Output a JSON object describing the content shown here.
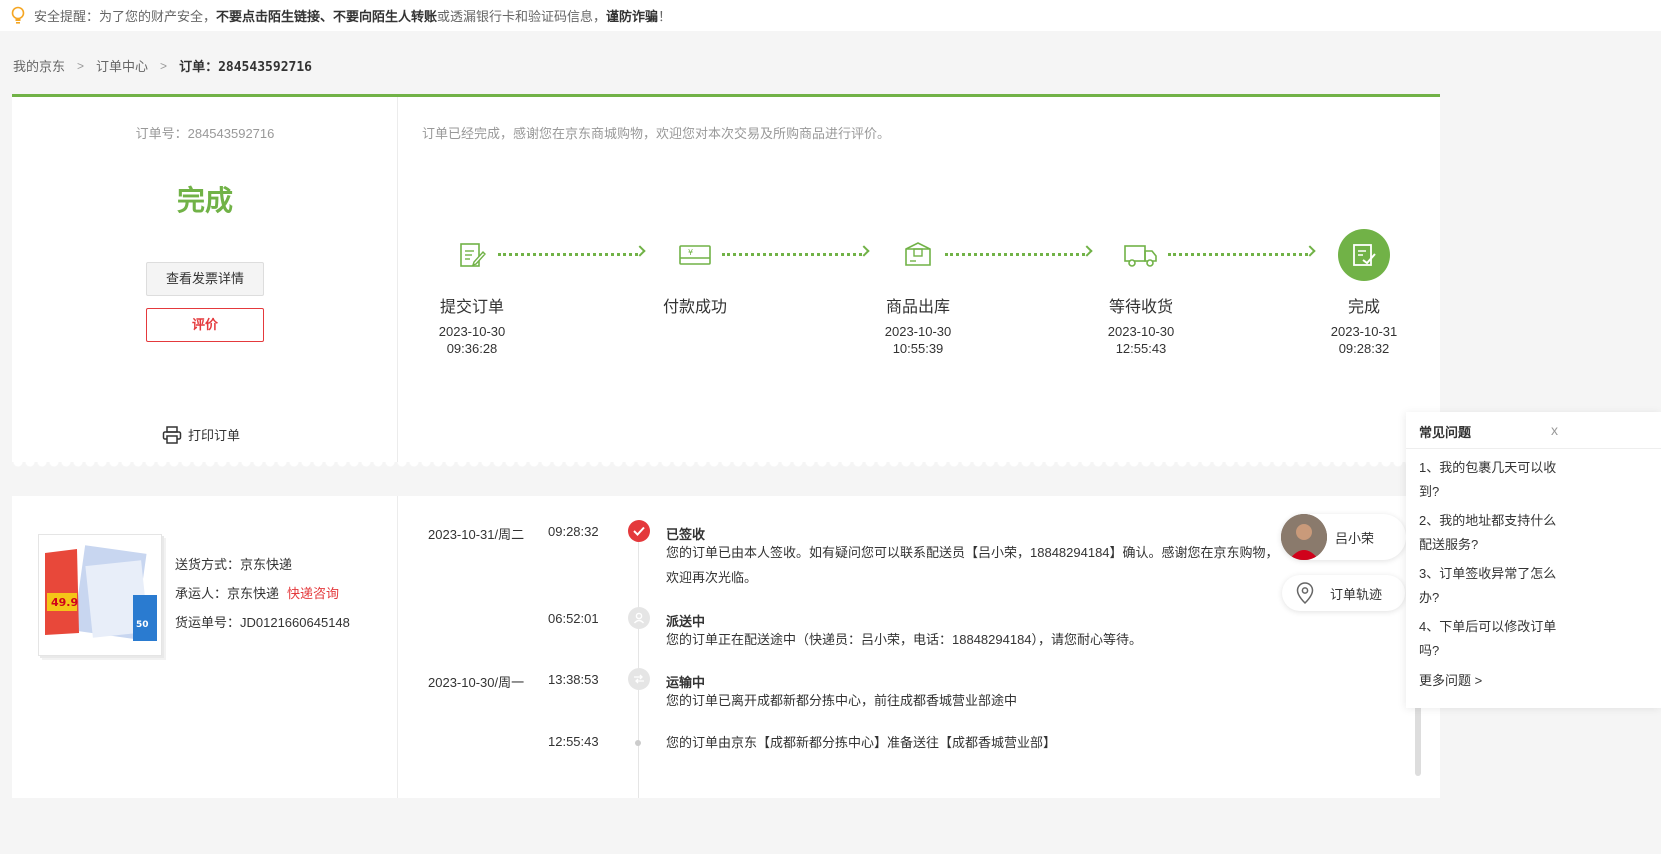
{
  "notice": {
    "prefix": "安全提醒：为了您的财产安全，",
    "bold1": "不要点击陌生链接、不要向陌生人转账",
    "middle": "或透漏银行卡和验证码信息，",
    "bold2": "谨防诈骗",
    "suffix": "！"
  },
  "breadcrumb": {
    "home": "我的京东",
    "center": "订单中心",
    "current_label": "订单：",
    "current_no": "284543592716"
  },
  "order": {
    "number_text": "订单号：284543592716",
    "status": "完成",
    "invoice_button": "查看发票详情",
    "review_button": "评价",
    "print_label": "打印订单",
    "thank_note": "订单已经完成，感谢您在京东商城购物，欢迎您对本次交易及所购商品进行评价。",
    "steps": [
      {
        "name": "提交订单",
        "date": "2023-10-30",
        "time": "09:36:28",
        "icon": "edit-icon"
      },
      {
        "name": "付款成功",
        "date": "",
        "time": "",
        "icon": "payment-card-icon"
      },
      {
        "name": "商品出库",
        "date": "2023-10-30",
        "time": "10:55:39",
        "icon": "package-box-icon"
      },
      {
        "name": "等待收货",
        "date": "2023-10-30",
        "time": "12:55:43",
        "icon": "truck-icon"
      },
      {
        "name": "完成",
        "date": "2023-10-31",
        "time": "09:28:32",
        "icon": "check-document-icon"
      }
    ]
  },
  "shipment": {
    "method": "送货方式：京东快递",
    "carrier": "承运人：京东快递",
    "carrier_link": "快递咨询",
    "tracking": "货运单号：JD0121660645148",
    "product_badge": "49.9",
    "product_size": "50",
    "events": [
      {
        "date": "2023-10-31/周二",
        "time": "09:28:32",
        "title": "已签收",
        "desc": "您的订单已由本人签收。如有疑问您可以联系配送员【吕小荣，18848294184】确认。感谢您在京东购物，欢迎再次光临。"
      },
      {
        "date": "",
        "time": "06:52:01",
        "title": "派送中",
        "desc": "您的订单正在配送途中（快递员：吕小荣，电话：18848294184），请您耐心等待。"
      },
      {
        "date": "2023-10-30/周一",
        "time": "13:38:53",
        "title": "运输中",
        "desc": "您的订单已离开成都新都分拣中心，前往成都香城营业部途中"
      },
      {
        "date": "",
        "time": "12:55:43",
        "title": "",
        "desc": "您的订单由京东【成都新都分拣中心】准备送往【成都香城营业部】"
      }
    ]
  },
  "floating": {
    "courier_name": "吕小荣",
    "track_label": "订单轨迹"
  },
  "faq": {
    "title": "常见问题",
    "close": "x",
    "questions": [
      "1、我的包裹几天可以收到?",
      "2、我的地址都支持什么配送服务?",
      "3、订单签收异常了怎么办?",
      "4、下单后可以修改订单吗?"
    ],
    "more": "更多问题 >"
  },
  "colors": {
    "accent_green": "#71b247",
    "accent_red": "#e4393c"
  }
}
